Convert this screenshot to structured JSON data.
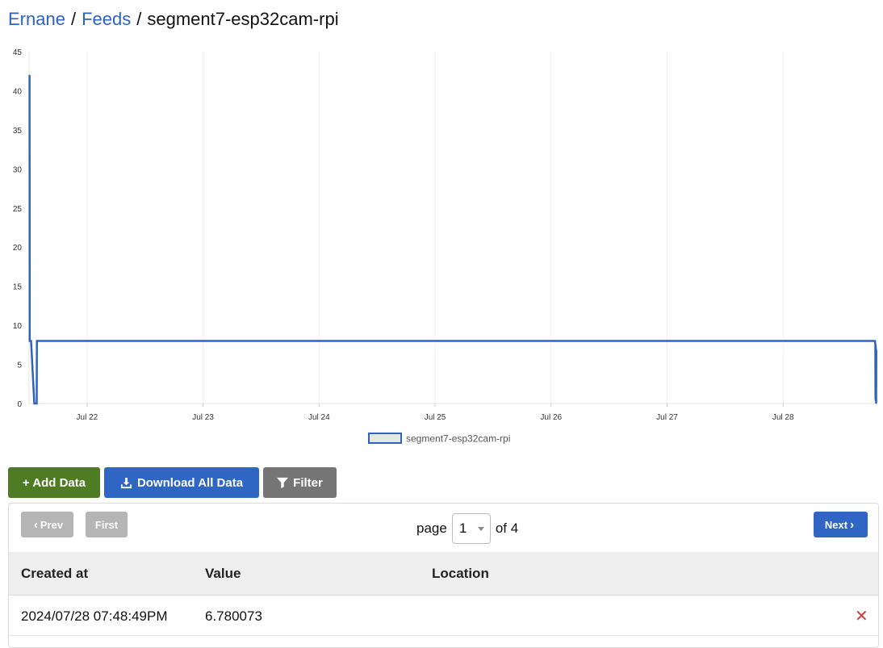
{
  "breadcrumb": {
    "user": "Ernane",
    "separator": "/",
    "feeds": "Feeds",
    "current": "segment7-esp32cam-rpi"
  },
  "colors": {
    "line": "#2e63c0",
    "add": "#4e7b23",
    "download": "#2f66c4",
    "filter": "#757575",
    "delete": "#d23b3b"
  },
  "chart_data": {
    "type": "line",
    "xlim": [
      "2024-07-21T12:00",
      "2024-07-28T19:20"
    ],
    "ylim": [
      0,
      45
    ],
    "y_ticks": [
      0,
      5,
      10,
      15,
      20,
      25,
      30,
      35,
      40,
      45
    ],
    "x_ticks": [
      {
        "x": "2024-07-22T00:00",
        "label": "Jul 22"
      },
      {
        "x": "2024-07-23T00:00",
        "label": "Jul 23"
      },
      {
        "x": "2024-07-24T00:00",
        "label": "Jul 24"
      },
      {
        "x": "2024-07-25T00:00",
        "label": "Jul 25"
      },
      {
        "x": "2024-07-26T00:00",
        "label": "Jul 26"
      },
      {
        "x": "2024-07-27T00:00",
        "label": "Jul 27"
      },
      {
        "x": "2024-07-28T00:00",
        "label": "Jul 28"
      }
    ],
    "grid": "x-only",
    "legend_position": "bottom-center",
    "series": [
      {
        "name": "segment7-esp32cam-rpi",
        "points": [
          {
            "x": "2024-07-21T12:06",
            "y": 42
          },
          {
            "x": "2024-07-21T12:08",
            "y": 8
          },
          {
            "x": "2024-07-21T12:25",
            "y": 8
          },
          {
            "x": "2024-07-21T13:05",
            "y": 0
          },
          {
            "x": "2024-07-21T13:35",
            "y": 0
          },
          {
            "x": "2024-07-21T13:37",
            "y": 8
          },
          {
            "x": "2024-07-28T19:00",
            "y": 8
          },
          {
            "x": "2024-07-28T19:05",
            "y": 7.6
          },
          {
            "x": "2024-07-28T19:07",
            "y": 0.5
          },
          {
            "x": "2024-07-28T19:09",
            "y": 7.5
          },
          {
            "x": "2024-07-28T19:11",
            "y": 0.3
          },
          {
            "x": "2024-07-28T19:13",
            "y": 7.1
          },
          {
            "x": "2024-07-28T19:15",
            "y": 0
          },
          {
            "x": "2024-07-28T19:17",
            "y": 6.78
          }
        ]
      }
    ]
  },
  "toolbar": {
    "add_label": "+ Add Data",
    "download_label": "Download All Data",
    "filter_label": "Filter"
  },
  "pagination": {
    "prev_label": "Prev",
    "first_label": "First",
    "page_label": "page",
    "current_page": "1",
    "of_label": "of 4",
    "next_label": "Next"
  },
  "table": {
    "headers": [
      "Created at",
      "Value",
      "Location"
    ],
    "rows": [
      {
        "created_at": "2024/07/28 07:48:49PM",
        "value": "6.780073",
        "location": ""
      }
    ]
  }
}
